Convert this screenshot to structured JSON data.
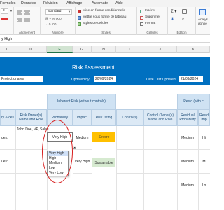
{
  "menu": [
    "Formules",
    "Données",
    "Révision",
    "Affichage",
    "Automate",
    "Aide"
  ],
  "ribbon": {
    "font_size": "9",
    "number_format": "Standard",
    "styles": [
      "Mise en forme conditionnelle",
      "Mettre sous forme de tableau",
      "Styles de cellules"
    ],
    "cells": [
      "Insérer",
      "Supprimer",
      "Format"
    ],
    "groups": [
      "Alignement",
      "Nombre",
      "Styles",
      "Cellules",
      "Édition",
      "Analys"
    ],
    "analyse_sub": "donné"
  },
  "formula_bar": {
    "text": "y High"
  },
  "columns": [
    "C",
    "D",
    "E",
    "F",
    "G",
    "H",
    "I",
    "J",
    "K"
  ],
  "sheet": {
    "title": "Risk Assessment",
    "project_label": "Project or area",
    "updated_by_label": "Updated by:",
    "updated_by_value": "20/09/2024",
    "date_last_updated_label": "Date Last Updated:",
    "date_last_updated_value": "21/09/2024",
    "inherent_risk_header": "Inherent Risk (without controls)",
    "residual_header": "Resid (with c",
    "headers": {
      "col_c": "ry & ces",
      "risk_owner": "Risk Owner(s) Name and Role",
      "probability": "Probability",
      "impact": "Impact",
      "risk_rating": "Risk rating",
      "controls": "Control(s)",
      "control_owner": "Control Owner(s) Name and Role",
      "residual_probability": "Residual Probability",
      "residual_impact": "Resid Imp"
    },
    "rows": [
      {
        "c": "ues:",
        "owner": "John Doe, VP, Sales.",
        "probability": "Very High",
        "impact": "Medium",
        "rating": "Severe",
        "residual_probability": "Medium",
        "residual_impact": "Hi"
      },
      {
        "c": "ues:",
        "owner": "",
        "probability": "Very High",
        "impact": "Very High",
        "rating": "Sustainable",
        "residual_probability": "Medium",
        "residual_impact": "M"
      },
      {
        "c": "",
        "owner": "",
        "residual_probability": "Medium",
        "residual_impact": "Lo"
      }
    ],
    "dropdown_options": [
      "Very High",
      "High",
      "Medium",
      "Low",
      "Very Low"
    ],
    "dropdown_selected": "Very High"
  },
  "colors": {
    "banner": "#0070c0",
    "severe": "#ffc000",
    "sustainable": "#d6ead0",
    "highlight": "#d81e1e"
  }
}
